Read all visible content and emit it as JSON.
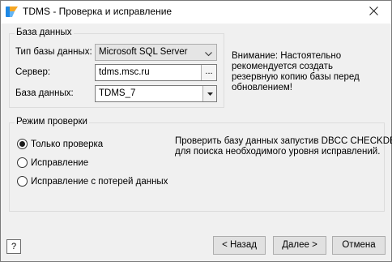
{
  "window": {
    "title": "TDMS - Проверка и исправление",
    "icons": {
      "app": "tdms-logo-icon",
      "close": "close-icon"
    }
  },
  "database_group": {
    "title": "База данных",
    "db_type_label": "Тип базы данных:",
    "db_type_value": "Microsoft SQL Server",
    "server_label": "Сервер:",
    "server_value": "tdms.msc.ru",
    "server_browse_label": "...",
    "database_label": "База данных:",
    "database_value": "TDMS_7"
  },
  "warning": {
    "line1": "Внимание: Настоятельно",
    "line2": "рекомендуется создать",
    "line3": "резервную копию базы перед",
    "line4": "обновлением!"
  },
  "mode_group": {
    "title": "Режим проверки",
    "options": [
      {
        "label": "Только проверка",
        "checked": true
      },
      {
        "label": "Исправление",
        "checked": false
      },
      {
        "label": "Исправление с потерей данных",
        "checked": false
      }
    ],
    "description_line1": "Проверить базу данных запустив DBCC CHECKDB",
    "description_line2": "для поиска необходимого уровня исправлений."
  },
  "footer": {
    "help_label": "?",
    "back_label": "< Назад",
    "next_label": "Далее >",
    "cancel_label": "Отмена"
  },
  "colors": {
    "window_bg": "#f0f0f0",
    "titlebar_bg": "#ffffff",
    "button_bg": "#e1e1e1",
    "button_border": "#adadad",
    "logo_blue": "#1e88e5",
    "logo_orange": "#f5a623"
  }
}
